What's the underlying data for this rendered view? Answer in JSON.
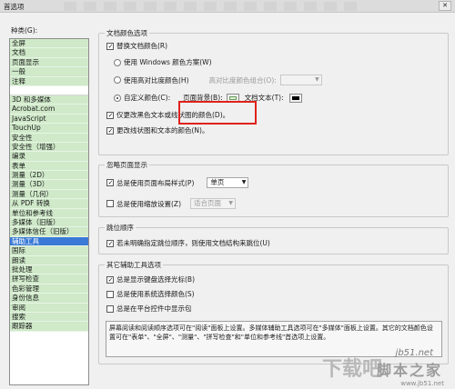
{
  "window": {
    "title": "首选项"
  },
  "categories": {
    "label": "种类(G):",
    "top": [
      "全屏",
      "文档",
      "页面显示",
      "一般",
      "注释"
    ],
    "items": [
      "3D 和多媒体",
      "Acrobat.com",
      "JavaScript",
      "TouchUp",
      "安全性",
      "安全性（增强）",
      "编录",
      "表单",
      "测量（2D）",
      "测量（3D）",
      "测量（几何）",
      "从 PDF 转换",
      "单位和参考线",
      "多媒体（旧版）",
      "多媒体信任（旧版）",
      "辅助工具",
      "国际",
      "朗读",
      "批处理",
      "拼写检查",
      "色彩管理",
      "身份信息",
      "审阅",
      "搜索",
      "跟踪器"
    ],
    "selected": "辅助工具"
  },
  "doc_colors": {
    "title": "文档颜色选项",
    "replace_label": "替换文档颜色(R)",
    "windows_scheme_label": "使用 Windows 颜色方案(W)",
    "high_contrast_label": "使用高对比度颜色(H)",
    "high_contrast_combo_label": "高对比度颜色组合(O):",
    "custom_label": "自定义颜色(C):",
    "page_bg_label": "页面背景(B):",
    "page_bg_color": "#d9f0d2",
    "doc_text_label": "文档文本(T):",
    "doc_text_color": "#000000",
    "only_black_label": "仅更改黑色文本或线状图的颜色(D)。",
    "change_lineart_label": "更改线状图和文本的颜色(N)。"
  },
  "page_display": {
    "title": "忽略页面显示",
    "always_layout_label": "总是使用页面布局样式(P)",
    "layout_value": "单页",
    "always_zoom_label": "总是使用缩放设置(Z)",
    "zoom_value": "适合页面"
  },
  "reading_order": {
    "title": "跳位顺序",
    "untagged_label": "若未明确指定跳位顺序，则使用文档结构来跳位(U)"
  },
  "other": {
    "title": "其它辅助工具选项",
    "keyboard_cursor_label": "总是显示键盘选择光标(B)",
    "system_selection_label": "总是使用系统选择颜色(S)",
    "show_portfolio_label": "总是在平台控件中显示包",
    "info_text": "屏幕阅读和阅读顺序选项可在\"阅读\"面板上设置。多媒体辅助工具选项可在\"多媒体\"面板上设置。其它的文档颜色设置可在\"表单\"、\"全屏\"、\"测量\"、\"拼写检查\"和\"单位和参考线\"首选项上设置。"
  },
  "watermark": {
    "logo": "下载吧",
    "site": "jb51.net",
    "brand": "脚本之家",
    "url": "www.jb51.net"
  }
}
